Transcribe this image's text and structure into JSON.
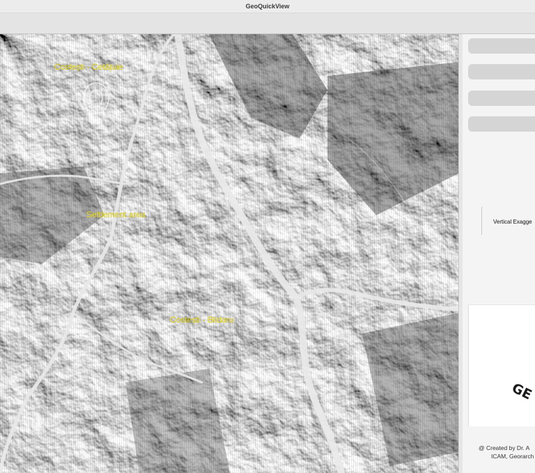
{
  "window": {
    "title": "GeoQuickView"
  },
  "map": {
    "labels": {
      "costesti_cetatuie": "Costești - Cetățuie",
      "settlement_area": "Settlement area",
      "costesti_blidaru": "Costești - Blidaru"
    },
    "label_color": "#f2e41c",
    "river_color": "#e9e9e9"
  },
  "panel": {
    "vertical_exaggeration_label": "Vertical Exagge",
    "logo_text": "GE",
    "credit_line1": "@ Created by Dr. A",
    "credit_line2": "ICAM, Georarch"
  }
}
